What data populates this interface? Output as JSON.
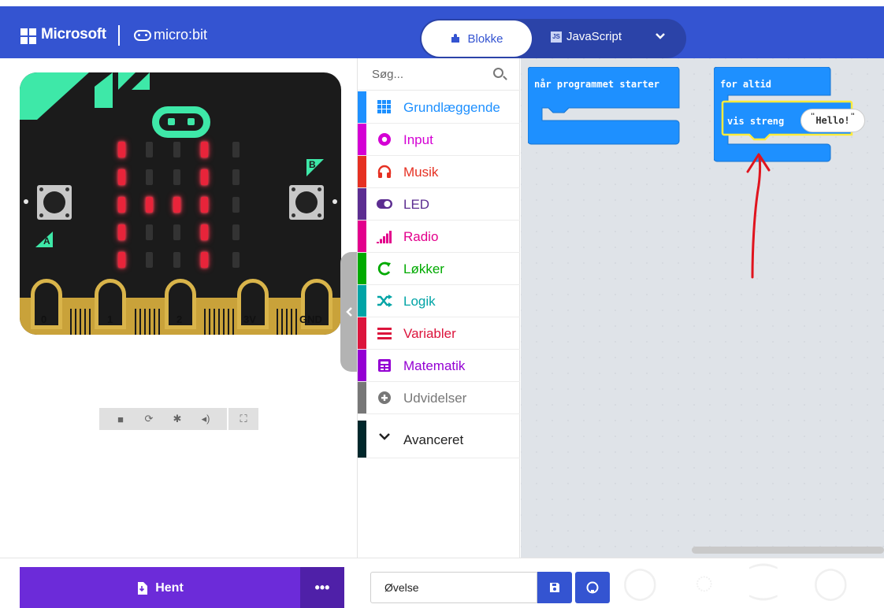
{
  "header": {
    "brand": "Microsoft",
    "product": "micro:bit",
    "tab_blocks": "Blokke",
    "tab_js": "JavaScript",
    "js_badge": "JS"
  },
  "simulator": {
    "pins": [
      "0",
      "1",
      "2",
      "3V",
      "GND"
    ],
    "button_a": "A",
    "button_b": "B",
    "led_matrix": [
      [
        1,
        0,
        0,
        1,
        0
      ],
      [
        1,
        0,
        0,
        1,
        0
      ],
      [
        1,
        1,
        1,
        1,
        0
      ],
      [
        1,
        0,
        0,
        1,
        0
      ],
      [
        1,
        0,
        0,
        1,
        0
      ]
    ],
    "controls": [
      "stop-icon",
      "restart-icon",
      "debug-icon",
      "mute-icon",
      "fullscreen-icon"
    ]
  },
  "toolbox": {
    "search_placeholder": "Søg...",
    "categories": [
      {
        "label": "Grundlæggende",
        "color": "#1e90ff",
        "icon": "grid-icon"
      },
      {
        "label": "Input",
        "color": "#d400d4",
        "icon": "input-circle-icon"
      },
      {
        "label": "Musik",
        "color": "#e63022",
        "icon": "headphones-icon"
      },
      {
        "label": "LED",
        "color": "#5c2d91",
        "icon": "toggle-icon"
      },
      {
        "label": "Radio",
        "color": "#e3008c",
        "icon": "signal-bars-icon"
      },
      {
        "label": "Løkker",
        "color": "#00aa00",
        "icon": "loop-arrow-icon"
      },
      {
        "label": "Logik",
        "color": "#00a4a6",
        "icon": "shuffle-icon"
      },
      {
        "label": "Variabler",
        "color": "#dc143c",
        "icon": "lines-icon"
      },
      {
        "label": "Matematik",
        "color": "#9400d3",
        "icon": "calculator-icon"
      },
      {
        "label": "Udvidelser",
        "color": "#777777",
        "icon": "plus-circle-icon"
      }
    ],
    "advanced_label": "Avanceret",
    "advanced_color": "#00272b"
  },
  "workspace": {
    "on_start_label": "når programmet starter",
    "forever_label": "for altid",
    "show_string_label": "vis streng",
    "string_value": "Hello!",
    "annotation_color": "#e0141e"
  },
  "footer": {
    "download_label": "Hent",
    "more_label": "•••",
    "project_name": "Øvelse"
  }
}
